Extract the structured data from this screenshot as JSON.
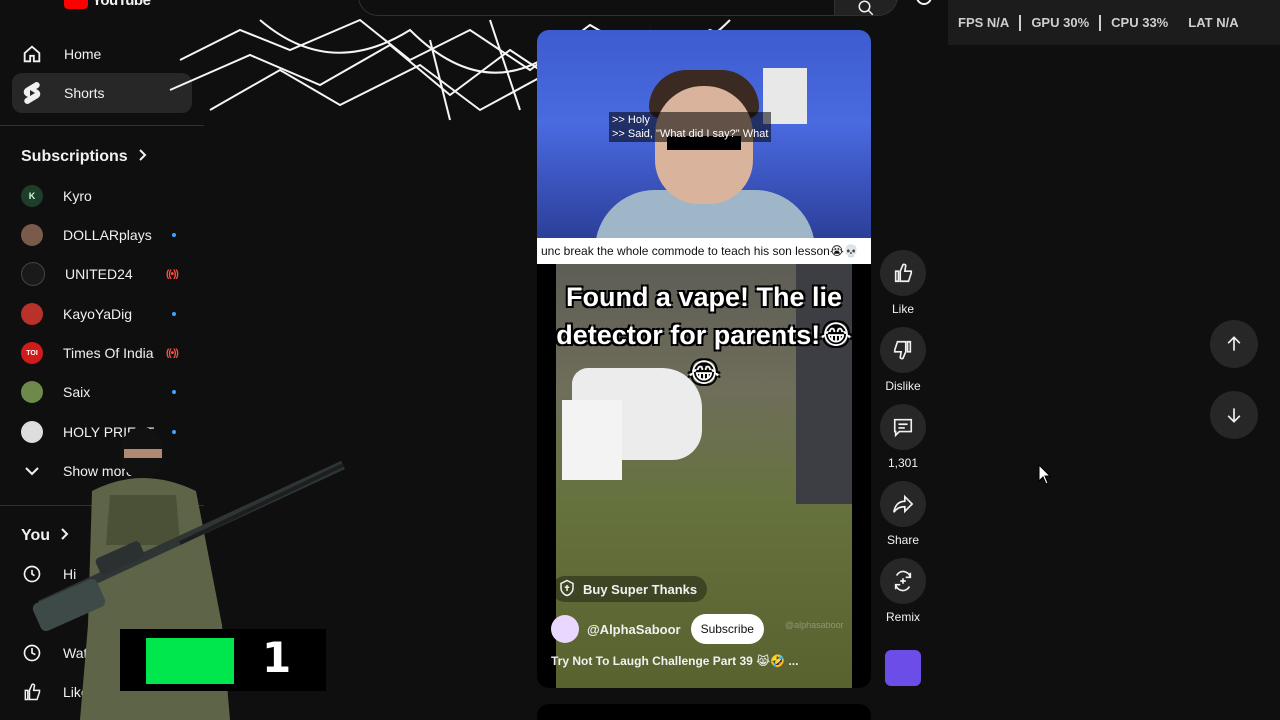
{
  "header": {
    "logo_text": "YouTube"
  },
  "perf_overlay": [
    {
      "label": "FPS",
      "value": "N/A"
    },
    {
      "label": "GPU",
      "value": "30%"
    },
    {
      "label": "CPU",
      "value": "33%"
    },
    {
      "label": "LAT",
      "value": "N/A"
    }
  ],
  "sidebar": {
    "nav": [
      {
        "label": "Home",
        "icon": "home-icon"
      },
      {
        "label": "Shorts",
        "icon": "shorts-icon",
        "active": true
      }
    ],
    "subscriptions_title": "Subscriptions",
    "subscriptions": [
      {
        "name": "Kyro",
        "avatar": "K",
        "color": "#1f3d2b",
        "status": "none"
      },
      {
        "name": "DOLLARplays",
        "avatar": "",
        "color": "#7a5a4a",
        "status": "new"
      },
      {
        "name": "UNITED24",
        "avatar": "",
        "color": "#1a1a1a",
        "status": "live"
      },
      {
        "name": "KayoYaDig",
        "avatar": "",
        "color": "#b8322a",
        "status": "new"
      },
      {
        "name": "Times Of India",
        "avatar": "TOI",
        "color": "#d11a1a",
        "status": "live"
      },
      {
        "name": "Saix",
        "avatar": "",
        "color": "#6e8a4a",
        "status": "new"
      },
      {
        "name": "HOLY PRIEST",
        "avatar": "",
        "color": "#dddddd",
        "status": "new"
      }
    ],
    "show_more": "Show more",
    "you_title": "You",
    "you_items": [
      {
        "label": "Hi",
        "icon": "history-icon"
      },
      {
        "label": "Watc",
        "icon": "watch-later-icon"
      },
      {
        "label": "Liked",
        "icon": "like-icon"
      }
    ]
  },
  "overlay_badge": {
    "number": "1",
    "accent": "#00e64d"
  },
  "short": {
    "captions": [
      ">> Holy",
      ">> Said, \"What did I say?\" What"
    ],
    "caption_strip": "unc break the whole commode to teach his son lesson😭💀",
    "video_text": "Found a vape! The lie detector for parents!😂😂",
    "super_thanks": "Buy Super Thanks",
    "channel_handle": "@AlphaSaboor",
    "subscribe": "Subscribe",
    "title": "Try Not To Laugh Challenge Part 39 😹🤣 ...",
    "watermark": "@alphasaboor"
  },
  "actions": [
    {
      "label": "Like",
      "icon": "thumbs-up-icon"
    },
    {
      "label": "Dislike",
      "icon": "thumbs-down-icon"
    },
    {
      "label": "1,301",
      "icon": "comment-icon"
    },
    {
      "label": "Share",
      "icon": "share-icon"
    },
    {
      "label": "Remix",
      "icon": "remix-icon"
    }
  ],
  "colors": {
    "background": "#0f0f0f",
    "surface": "#272727",
    "brand_red": "#ff0000",
    "new_dot": "#3ea6ff",
    "live": "#ff4e45"
  }
}
